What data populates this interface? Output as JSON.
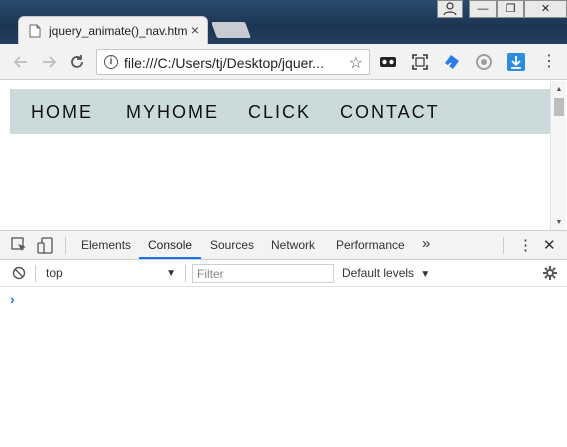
{
  "browser": {
    "tab_title": "jquery_animate()_nav.htm",
    "tab_close": "×",
    "address": "file:///C:/Users/tj/Desktop/jquer...",
    "window_controls": {
      "minimize": "—",
      "maximize": "❐",
      "close": "✕"
    }
  },
  "page": {
    "nav": [
      "HOME",
      "MYHOME",
      "CLICK",
      "CONTACT"
    ],
    "nav_bg": "#cbdbdb"
  },
  "devtools": {
    "tabs": [
      "Elements",
      "Console",
      "Sources",
      "Network",
      "Performance"
    ],
    "active_tab": "Console",
    "more_tabs": "»",
    "context": "top",
    "filter_placeholder": "Filter",
    "levels": "Default levels",
    "prompt": "›",
    "accent": "#1a73e8"
  }
}
